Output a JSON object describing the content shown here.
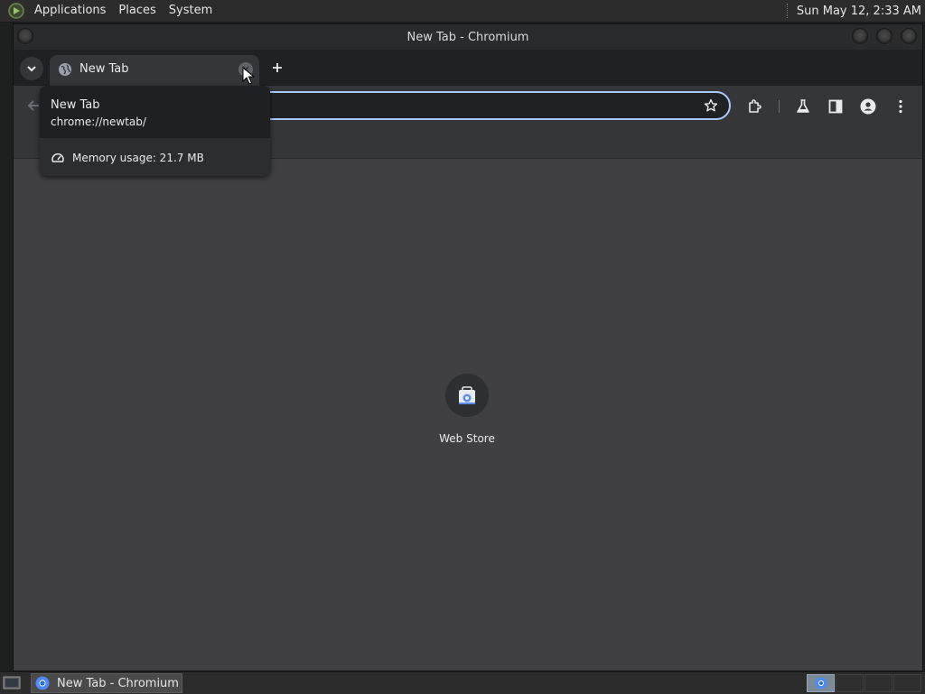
{
  "top_panel": {
    "menus": [
      "Applications",
      "Places",
      "System"
    ],
    "clock": "Sun May 12,  2:33 AM"
  },
  "window": {
    "title": "New Tab - Chromium"
  },
  "tabs": [
    {
      "title": "New Tab",
      "active": true
    }
  ],
  "toolbar": {
    "omnibox_value": ""
  },
  "hover_card": {
    "title": "New Tab",
    "url": "chrome://newtab/",
    "memory": "Memory usage: 21.7 MB"
  },
  "shortcuts": [
    {
      "label": "Web Store",
      "icon": "web-store-icon"
    }
  ],
  "taskbar": {
    "items": [
      {
        "label": "New Tab - Chromium",
        "icon": "chromium-icon"
      }
    ]
  },
  "colors": {
    "accent": "#a8c7fa",
    "content_bg": "#3f3f44",
    "toolbar_bg": "#35363a",
    "tabstrip_bg": "#202124"
  }
}
